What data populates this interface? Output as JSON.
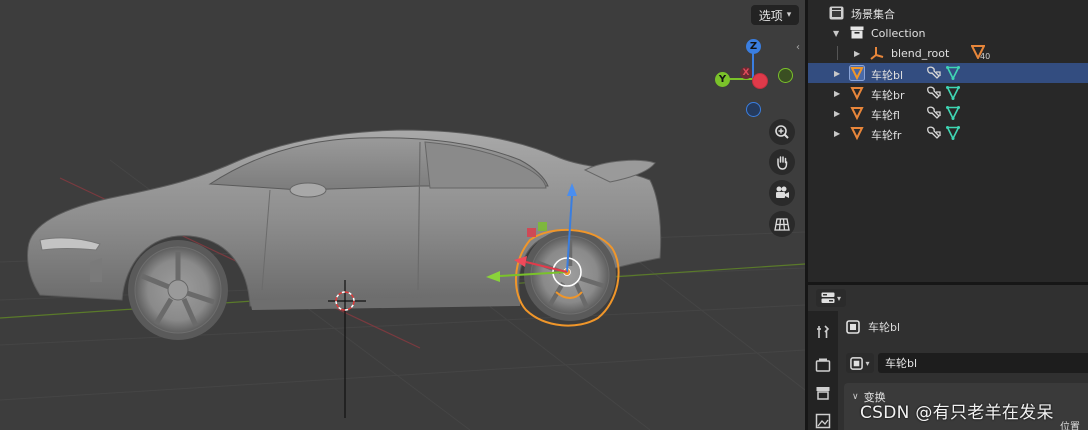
{
  "viewport": {
    "options_label": "选项",
    "gizmo": {
      "z": "Z",
      "y": "Y",
      "x": "X"
    },
    "nav_tools": [
      {
        "name": "zoom-icon"
      },
      {
        "name": "hand-pan-icon"
      },
      {
        "name": "camera-icon"
      },
      {
        "name": "grid-ortho-icon"
      }
    ],
    "watermark": "CSDN @有只老羊在发呆",
    "cut_label": "位置 x"
  },
  "outliner": {
    "root_label": "场景集合",
    "collection_label": "Collection",
    "blend_root_label": "blend_root",
    "blend_root_children": "40",
    "objects": [
      {
        "label": "车轮bl",
        "selected": true
      },
      {
        "label": "车轮br",
        "selected": false
      },
      {
        "label": "车轮fl",
        "selected": false
      },
      {
        "label": "车轮fr",
        "selected": false
      }
    ]
  },
  "properties": {
    "object_title": "车轮bl",
    "name_field_value": "车轮bl",
    "transform_panel": "变换",
    "tabs": [
      {
        "name": "tool-tab-icon"
      },
      {
        "name": "render-tab-icon"
      },
      {
        "name": "output-tab-icon"
      },
      {
        "name": "view-layer-tab-icon"
      }
    ]
  },
  "colors": {
    "selection_blue": "#334d80",
    "object_orange": "#e8863a",
    "modifier_teal": "#3fd6b4",
    "axis_x": "#e03a4a",
    "axis_y": "#7ac22a",
    "axis_z": "#3a7ee0"
  }
}
